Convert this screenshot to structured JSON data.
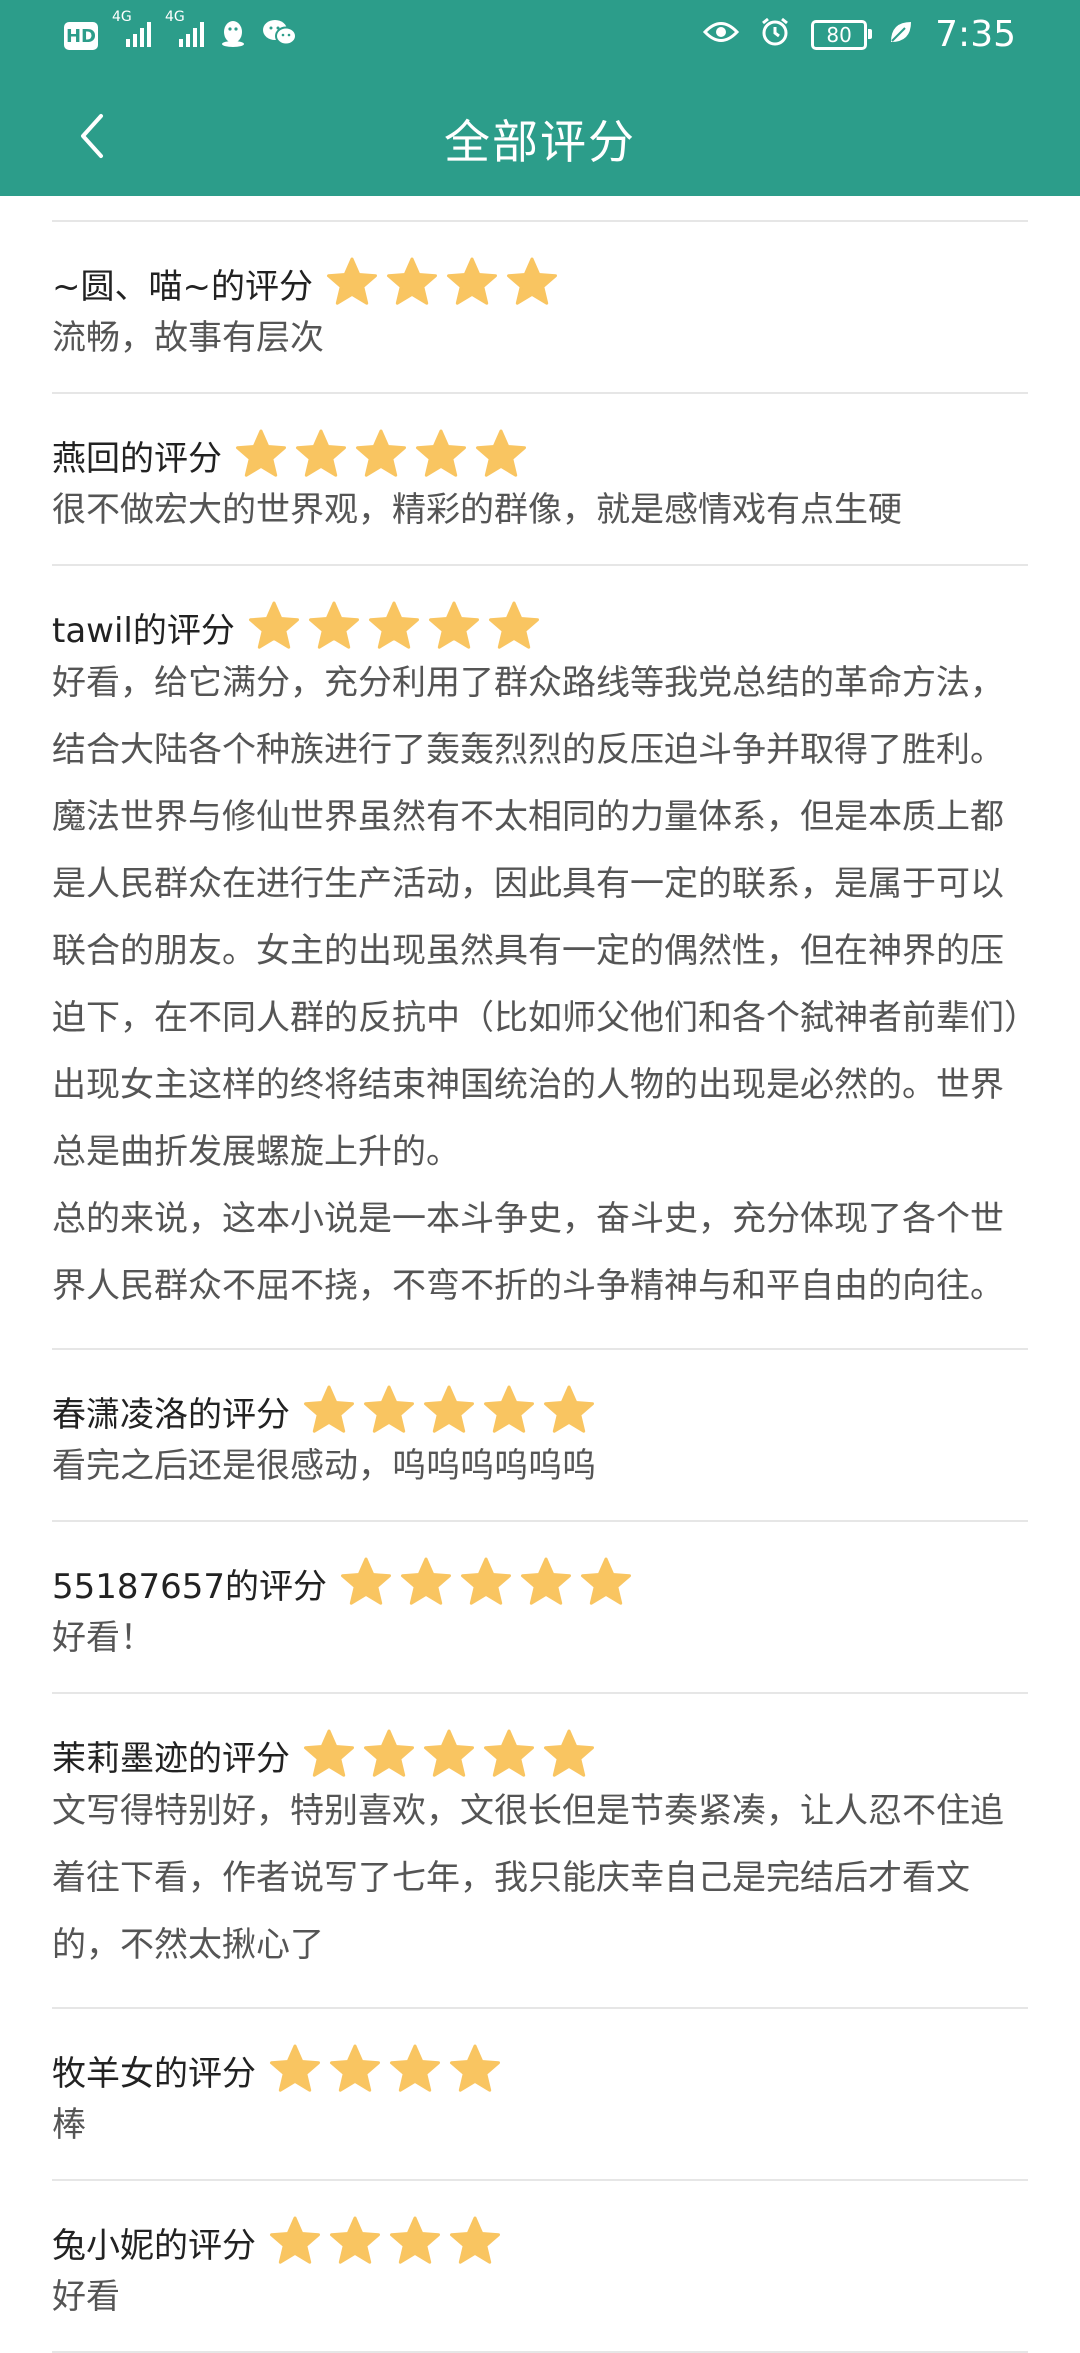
{
  "status_bar": {
    "hd": "HD",
    "signal1": "4G",
    "signal2": "4G",
    "battery": "80",
    "time": "7:35",
    "icons": [
      "penguin-icon",
      "wechat-icon",
      "eye-icon",
      "alarm-icon",
      "leaf-icon"
    ]
  },
  "header": {
    "title": "全部评分",
    "color": "#2c9d8a"
  },
  "star_color": "#f9c561",
  "reviews": [
    {
      "rater": "~圆、喵~的评分",
      "stars": 4,
      "comment": "流畅，故事有层次"
    },
    {
      "rater": "燕回的评分",
      "stars": 5,
      "comment": "很不做宏大的世界观，精彩的群像，就是感情戏有点生硬"
    },
    {
      "rater": "tawil的评分",
      "stars": 5,
      "comment": "好看，给它满分，充分利用了群众路线等我党总结的革命方法，结合大陆各个种族进行了轰轰烈烈的反压迫斗争并取得了胜利。魔法世界与修仙世界虽然有不太相同的力量体系，但是本质上都是人民群众在进行生产活动，因此具有一定的联系，是属于可以联合的朋友。女主的出现虽然具有一定的偶然性，但在神界的压迫下，在不同人群的反抗中（比如师父他们和各个弑神者前辈们）出现女主这样的终将结束神国统治的人物的出现是必然的。世界总是曲折发展螺旋上升的。\n总的来说，这本小说是一本斗争史，奋斗史，充分体现了各个世界人民群众不屈不挠，不弯不折的斗争精神与和平自由的向往。"
    },
    {
      "rater": "春潇凌洛的评分",
      "stars": 5,
      "comment": "看完之后还是很感动，呜呜呜呜呜呜"
    },
    {
      "rater": "55187657的评分",
      "stars": 5,
      "comment": "好看！"
    },
    {
      "rater": "茉莉墨迹的评分",
      "stars": 5,
      "comment": "文写得特别好，特别喜欢，文很长但是节奏紧凑，让人忍不住追着往下看，作者说写了七年，我只能庆幸自己是完结后才看文的，不然太揪心了"
    },
    {
      "rater": "牧羊女的评分",
      "stars": 4,
      "comment": "棒"
    },
    {
      "rater": "兔小妮的评分",
      "stars": 4,
      "comment": "好看"
    }
  ]
}
